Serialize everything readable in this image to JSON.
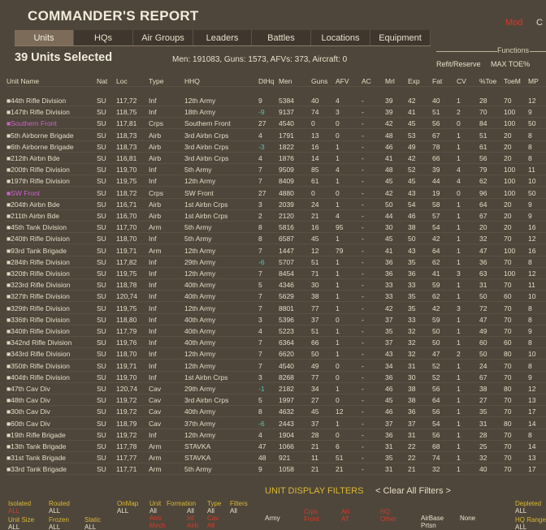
{
  "window": {
    "title": "COMMANDER'S REPORT",
    "corner_mod": "Mod",
    "corner_c": "C"
  },
  "tabs": [
    {
      "label": "Units",
      "active": true
    },
    {
      "label": "HQs"
    },
    {
      "label": "Air Groups"
    },
    {
      "label": "Leaders"
    },
    {
      "label": "Battles"
    },
    {
      "label": "Locations"
    },
    {
      "label": "Equipment"
    }
  ],
  "header": {
    "selected_count": "39 Units Selected",
    "summary": "Men: 191083, Guns: 1573, AFVs: 373, Aircraft: 0",
    "functions_label": "Functions",
    "refit_reserve": "Refit/Reserve",
    "max_toe": "MAX TOE%"
  },
  "table": {
    "columns": [
      "Unit Name",
      "Nat",
      "Loc",
      "Type",
      "HHQ",
      "DtHq",
      "Men",
      "Guns",
      "AFV",
      "AC",
      "Mrl",
      "Exp",
      "Fat",
      "CV",
      "%Toe",
      "ToeM",
      "MP"
    ],
    "rows": [
      [
        "44th Rifle Division",
        "SU",
        "117,72",
        "Inf",
        "12th Army",
        "9",
        "5384",
        "40",
        "4",
        "-",
        "39",
        "42",
        "40",
        "1",
        "28",
        "70",
        "12"
      ],
      [
        "147th Rifle Division",
        "SU",
        "118,75",
        "Inf",
        "18th Army",
        "-9",
        "9137",
        "74",
        "3",
        "-",
        "39",
        "41",
        "51",
        "2",
        "70",
        "100",
        "9"
      ],
      [
        "Southern Front",
        "SU",
        "117,81",
        "Crps",
        "Southern Front",
        "27",
        "4540",
        "0",
        "0",
        "-",
        "42",
        "45",
        "56",
        "0",
        "84",
        "100",
        "50"
      ],
      [
        "5th Airborne Brigade",
        "SU",
        "118,73",
        "Airb",
        "3rd Airbn Crps",
        "4",
        "1791",
        "13",
        "0",
        "-",
        "48",
        "53",
        "67",
        "1",
        "51",
        "20",
        "8"
      ],
      [
        "6th Airborne Brigade",
        "SU",
        "118,73",
        "Airb",
        "3rd Airbn Crps",
        "-3",
        "1822",
        "16",
        "1",
        "-",
        "46",
        "49",
        "78",
        "1",
        "61",
        "20",
        "8"
      ],
      [
        "212th Airbn Bde",
        "SU",
        "116,81",
        "Airb",
        "3rd Airbn Crps",
        "4",
        "1876",
        "14",
        "1",
        "-",
        "41",
        "42",
        "66",
        "1",
        "56",
        "20",
        "8"
      ],
      [
        "200th Rifle Division",
        "SU",
        "119,70",
        "Inf",
        "5th Army",
        "7",
        "9509",
        "85",
        "4",
        "-",
        "48",
        "52",
        "39",
        "4",
        "79",
        "100",
        "11"
      ],
      [
        "197th Rifle Division",
        "SU",
        "119,75",
        "Inf",
        "12th Army",
        "7",
        "8409",
        "61",
        "1",
        "-",
        "45",
        "45",
        "44",
        "4",
        "62",
        "100",
        "10"
      ],
      [
        "SW Front",
        "SU",
        "118,72",
        "Crps",
        "SW Front",
        "27",
        "4880",
        "0",
        "0",
        "-",
        "42",
        "43",
        "19",
        "0",
        "96",
        "100",
        "50"
      ],
      [
        "204th Airbn Bde",
        "SU",
        "116,71",
        "Airb",
        "1st Airbn Crps",
        "3",
        "2039",
        "24",
        "1",
        "-",
        "50",
        "54",
        "58",
        "1",
        "64",
        "20",
        "9"
      ],
      [
        "211th Airbn Bde",
        "SU",
        "116,70",
        "Airb",
        "1st Airbn Crps",
        "2",
        "2120",
        "21",
        "4",
        "-",
        "44",
        "46",
        "57",
        "1",
        "67",
        "20",
        "9"
      ],
      [
        "45th Tank Division",
        "SU",
        "117,70",
        "Arm",
        "5th Army",
        "8",
        "5816",
        "16",
        "95",
        "-",
        "30",
        "38",
        "54",
        "1",
        "20",
        "20",
        "16"
      ],
      [
        "240th Rifle Division",
        "SU",
        "118,70",
        "Inf",
        "5th Army",
        "8",
        "6587",
        "45",
        "1",
        "-",
        "45",
        "50",
        "42",
        "1",
        "32",
        "70",
        "12"
      ],
      [
        "93rd Tank Brigade",
        "SU",
        "119,71",
        "Arm",
        "12th Army",
        "7",
        "1447",
        "12",
        "79",
        "-",
        "41",
        "43",
        "64",
        "1",
        "47",
        "100",
        "16"
      ],
      [
        "284th Rifle Division",
        "SU",
        "117,82",
        "Inf",
        "29th Army",
        "-6",
        "5707",
        "51",
        "1",
        "-",
        "36",
        "35",
        "62",
        "1",
        "36",
        "70",
        "8"
      ],
      [
        "320th Rifle Division",
        "SU",
        "119,75",
        "Inf",
        "12th Army",
        "7",
        "8454",
        "71",
        "1",
        "-",
        "36",
        "36",
        "41",
        "3",
        "63",
        "100",
        "12"
      ],
      [
        "323rd Rifle Division",
        "SU",
        "118,78",
        "Inf",
        "40th Army",
        "5",
        "4346",
        "30",
        "1",
        "-",
        "33",
        "33",
        "59",
        "1",
        "31",
        "70",
        "11"
      ],
      [
        "327th Rifle Division",
        "SU",
        "120,74",
        "Inf",
        "40th Army",
        "7",
        "5629",
        "38",
        "1",
        "-",
        "33",
        "35",
        "62",
        "1",
        "50",
        "60",
        "10"
      ],
      [
        "329th Rifle Division",
        "SU",
        "119,75",
        "Inf",
        "12th Army",
        "7",
        "8801",
        "77",
        "1",
        "-",
        "42",
        "35",
        "42",
        "3",
        "72",
        "70",
        "8"
      ],
      [
        "336th Rifle Division",
        "SU",
        "118,80",
        "Inf",
        "40th Army",
        "3",
        "5396",
        "37",
        "0",
        "-",
        "37",
        "33",
        "59",
        "1",
        "47",
        "70",
        "8"
      ],
      [
        "340th Rifle Division",
        "SU",
        "117,79",
        "Inf",
        "40th Army",
        "4",
        "5223",
        "51",
        "1",
        "-",
        "35",
        "32",
        "50",
        "1",
        "49",
        "70",
        "9"
      ],
      [
        "342nd Rifle Division",
        "SU",
        "119,76",
        "Inf",
        "40th Army",
        "7",
        "6364",
        "66",
        "1",
        "-",
        "37",
        "32",
        "50",
        "1",
        "60",
        "60",
        "8"
      ],
      [
        "343rd Rifle Division",
        "SU",
        "118,70",
        "Inf",
        "12th Army",
        "7",
        "6620",
        "50",
        "1",
        "-",
        "43",
        "32",
        "47",
        "2",
        "50",
        "80",
        "10"
      ],
      [
        "350th Rifle Division",
        "SU",
        "119,71",
        "Inf",
        "12th Army",
        "7",
        "4540",
        "49",
        "0",
        "-",
        "34",
        "31",
        "52",
        "1",
        "24",
        "70",
        "8"
      ],
      [
        "404th Rifle Division",
        "SU",
        "119,70",
        "Inf",
        "1st Airbn Crps",
        "3",
        "8268",
        "77",
        "0",
        "-",
        "36",
        "30",
        "52",
        "1",
        "67",
        "70",
        "9"
      ],
      [
        "47th Cav Div",
        "SU",
        "120,74",
        "Cav",
        "29th Army",
        "-1",
        "2182",
        "34",
        "1",
        "-",
        "46",
        "38",
        "56",
        "1",
        "38",
        "80",
        "12"
      ],
      [
        "48th Cav Div",
        "SU",
        "119,72",
        "Cav",
        "3rd Airbn Crps",
        "5",
        "1997",
        "27",
        "0",
        "-",
        "45",
        "38",
        "64",
        "1",
        "27",
        "70",
        "13"
      ],
      [
        "30th Cav Div",
        "SU",
        "119,72",
        "Cav",
        "40th Army",
        "8",
        "4632",
        "45",
        "12",
        "-",
        "46",
        "36",
        "56",
        "1",
        "35",
        "70",
        "17"
      ],
      [
        "60th Cav Div",
        "SU",
        "118,79",
        "Cav",
        "37th Army",
        "-6",
        "2443",
        "37",
        "1",
        "-",
        "37",
        "37",
        "54",
        "1",
        "31",
        "80",
        "14"
      ],
      [
        "19th Rifle Brigade",
        "SU",
        "119,72",
        "Inf",
        "12th Army",
        "4",
        "1904",
        "28",
        "0",
        "-",
        "36",
        "31",
        "56",
        "1",
        "28",
        "70",
        "8"
      ],
      [
        "13th Tank Brigade",
        "SU",
        "117,78",
        "Arm",
        "STAVKA",
        "47",
        "1066",
        "21",
        "6",
        "-",
        "31",
        "22",
        "68",
        "1",
        "25",
        "70",
        "14"
      ],
      [
        "31st Tank Brigade",
        "SU",
        "117,77",
        "Arm",
        "STAVKA",
        "48",
        "921",
        "11",
        "51",
        "-",
        "35",
        "22",
        "74",
        "1",
        "32",
        "70",
        "13"
      ],
      [
        "33rd Tank Brigade",
        "SU",
        "117,71",
        "Arm",
        "5th Army",
        "9",
        "1058",
        "21",
        "21",
        "-",
        "31",
        "21",
        "32",
        "1",
        "40",
        "70",
        "17"
      ]
    ],
    "highlight_rows": [
      2,
      8
    ],
    "cyan_dthq_rows": [
      1,
      4,
      14,
      25,
      28
    ]
  },
  "filters": {
    "title": "UNIT DISPLAY FILTERS",
    "clear": "< Clear All Filters >",
    "isolated_label": "Isolated",
    "isolated_value": "ALL",
    "routed_label": "Routed",
    "routed_value": "ALL",
    "onmap_label": "OnMap",
    "onmap_value": "ALL",
    "unit_label": "Unit",
    "formation_label": "Formation",
    "type_label": "Type",
    "filters_label": "Filters",
    "unit_value": "All",
    "formation_value": "All",
    "type_value": "All",
    "filters_value": "All",
    "arm_mech": "Arm\nMech",
    "inf": "Inf\nAirb",
    "cav": "Cav\nAll",
    "army": "Army",
    "crps": "Crps\nFront",
    "art": "Art\nAT",
    "hq": "HQ\nOther",
    "air_base": "AirBase",
    "prtsn": "Prtsn",
    "none": "None",
    "depleted_label": "Depleted",
    "depleted_value": "ALL",
    "unit_size_label": "Unit Size",
    "unit_size_value": "ALL",
    "frozen_label": "Frozen",
    "frozen_value": "ALL",
    "static_label": "Static",
    "static_value": "ALL",
    "hq_range_label": "HQ Range",
    "hq_range_value": "ALL"
  }
}
